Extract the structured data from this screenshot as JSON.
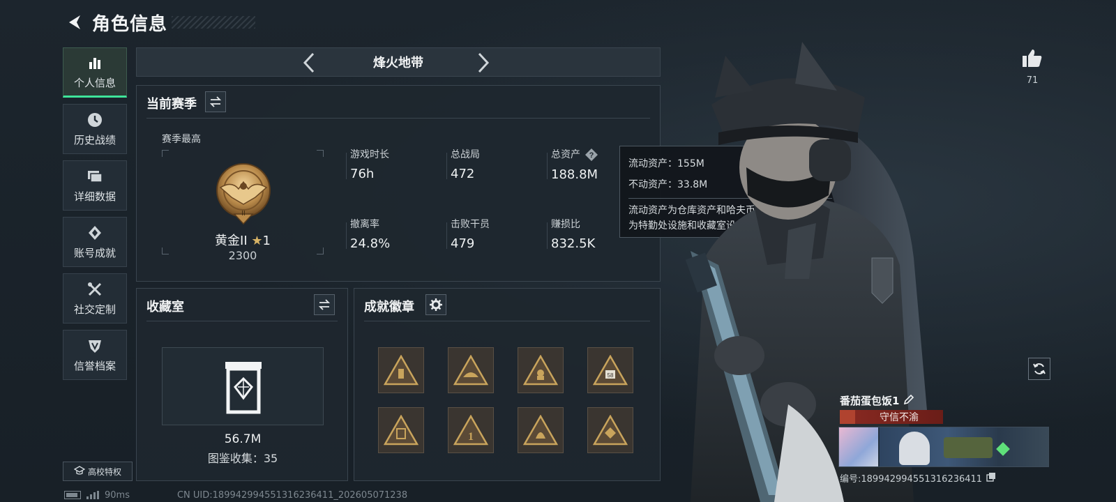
{
  "header": {
    "title": "角色信息"
  },
  "sidebar": {
    "items": [
      {
        "label": "个人信息",
        "icon": "bar-chart-icon",
        "active": true
      },
      {
        "label": "历史战绩",
        "icon": "clock-icon"
      },
      {
        "label": "详细数据",
        "icon": "folder-icon"
      },
      {
        "label": "账号成就",
        "icon": "medal-icon"
      },
      {
        "label": "社交定制",
        "icon": "tools-icon"
      },
      {
        "label": "信誉档案",
        "icon": "shield-icon"
      }
    ],
    "campus_label": "高校特权"
  },
  "mode": {
    "name": "烽火地带"
  },
  "season": {
    "title": "当前赛季",
    "sub": "赛季最高",
    "rank_name": "黄金II",
    "rank_stars": "1",
    "rank_score": "2300",
    "stats": [
      {
        "label": "游戏时长",
        "value": "76h"
      },
      {
        "label": "总战局",
        "value": "472"
      },
      {
        "label": "总资产",
        "value": "188.8M"
      },
      {
        "label": "撤离率",
        "value": "24.8%"
      },
      {
        "label": "击败干员",
        "value": "479"
      },
      {
        "label": "赚损比",
        "value": "832.5K"
      }
    ]
  },
  "tooltip": {
    "liquid": "流动资产：155M",
    "fixed": "不动资产：33.8M",
    "desc_line1": "流动资产为仓库资产和哈夫币，不动资产",
    "desc_line2": "为特勤处设施和收藏室设施"
  },
  "collection": {
    "title": "收藏室",
    "value": "56.7M",
    "count": "图鉴收集：35"
  },
  "badges": {
    "title": "成就徽章",
    "items": [
      "badge-1",
      "badge-2",
      "badge-3",
      "badge-4",
      "badge-5",
      "badge-6",
      "badge-7",
      "badge-8"
    ]
  },
  "profile": {
    "likes": "71",
    "player_name": "番茄蛋包饭1",
    "title_tag": "守信不渝",
    "player_id": "编号:18994299455131623641​1"
  },
  "status": {
    "ping": "90ms",
    "uid": "CN UID:18994299455131623641​1_202605071238"
  },
  "colors": {
    "accent": "#3ee49a",
    "badge_gold": "#c9a45c",
    "title_red": "#8a2a22"
  }
}
